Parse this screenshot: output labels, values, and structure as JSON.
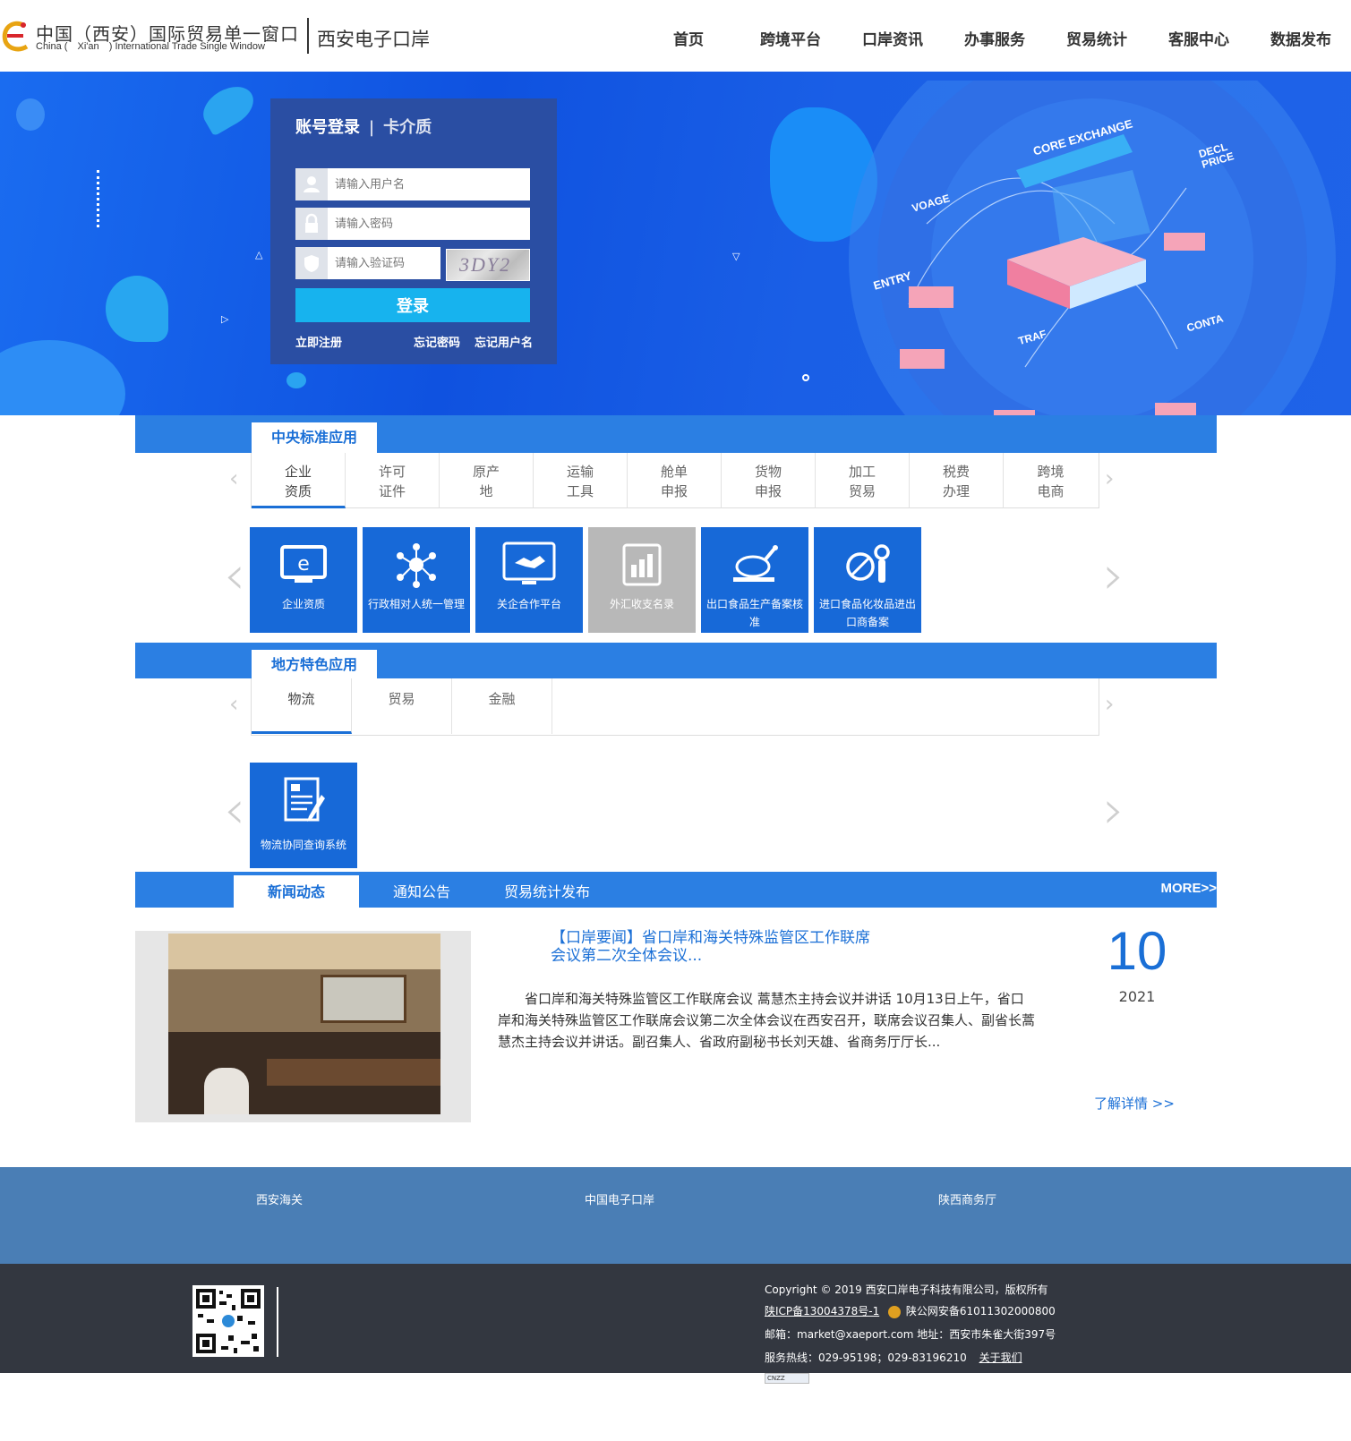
{
  "header": {
    "logo_cn": "中国（西安）国际贸易单一窗口",
    "logo_en_prefix": "China (",
    "logo_en_city": "Xi'an",
    "logo_en_suffix": ") International Trade Single Window",
    "site_name": "西安电子口岸",
    "nav": [
      "首页",
      "跨境平台",
      "口岸资讯",
      "办事服务",
      "贸易统计",
      "客服中心",
      "数据发布"
    ]
  },
  "banner": {
    "graphic_labels": [
      "CORE EXCHANGE",
      "DECL PRICE",
      "VOAGE",
      "ENTRY",
      "TRAF",
      "CONTA"
    ]
  },
  "login": {
    "tab_account": "账号登录",
    "tab_sep": "|",
    "tab_card": "卡介质",
    "username_placeholder": "请输入用户名",
    "password_placeholder": "请输入密码",
    "captcha_placeholder": "请输入验证码",
    "captcha_text": "3DY2",
    "submit_label": "登录",
    "register_link": "立即注册",
    "forgot_password_link": "忘记密码",
    "forgot_username_link": "忘记用户名"
  },
  "central": {
    "title": "中央标准应用",
    "subtabs": [
      {
        "line1": "企业",
        "line2": "资质"
      },
      {
        "line1": "许可",
        "line2": "证件"
      },
      {
        "line1": "原产",
        "line2": "地"
      },
      {
        "line1": "运输",
        "line2": "工具"
      },
      {
        "line1": "舱单",
        "line2": "申报"
      },
      {
        "line1": "货物",
        "line2": "申报"
      },
      {
        "line1": "加工",
        "line2": "贸易"
      },
      {
        "line1": "税费",
        "line2": "办理"
      },
      {
        "line1": "跨境",
        "line2": "电商"
      }
    ],
    "tiles": [
      "企业资质",
      "行政相对人统一管理",
      "关企合作平台",
      "外汇收支名录",
      "出口食品生产备案核准",
      "进口食品化妆品进出口商备案"
    ]
  },
  "local": {
    "title": "地方特色应用",
    "subtabs": [
      "物流",
      "贸易",
      "金融"
    ],
    "tiles": [
      "物流协同查询系统"
    ]
  },
  "news": {
    "tabs": [
      "新闻动态",
      "通知公告",
      "贸易统计发布"
    ],
    "more": "MORE>>",
    "title": "【口岸要闻】省口岸和海关特殊监管区工作联席会议第二次全体会议...",
    "body": "省口岸和海关特殊监管区工作联席会议 蒿慧杰主持会议并讲话 10月13日上午，省口岸和海关特殊监管区工作联席会议第二次全体会议在西安召开，联席会议召集人、副省长蒿慧杰主持会议并讲话。副召集人、省政府副秘书长刘天雄、省商务厅厅长...",
    "day": "10",
    "year": "2021",
    "detail_link": "了解详情 >>"
  },
  "footer_links": [
    "西安海关",
    "中国电子口岸",
    "陕西商务厅"
  ],
  "footer": {
    "copyright": "Copyright © 2019 西安口岸电子科技有限公司，版权所有",
    "icp": "陕ICP备13004378号-1",
    "police": "陕公网安备61011302000800",
    "email_label": "邮箱：market@xaeport.com 地址：西安市朱雀大街397号",
    "hotline": "服务热线：029-95198；029-83196210",
    "about": "关于我们",
    "badge": "CNZZ"
  },
  "colors": {
    "primary": "#1a6fd6",
    "bar": "#2b7fe3",
    "banner": "#1463e6",
    "login_panel": "#2a4ea3",
    "login_button": "#17b3ee",
    "footer_links_bg": "#4a7eb5",
    "footer_bg": "#333740"
  }
}
